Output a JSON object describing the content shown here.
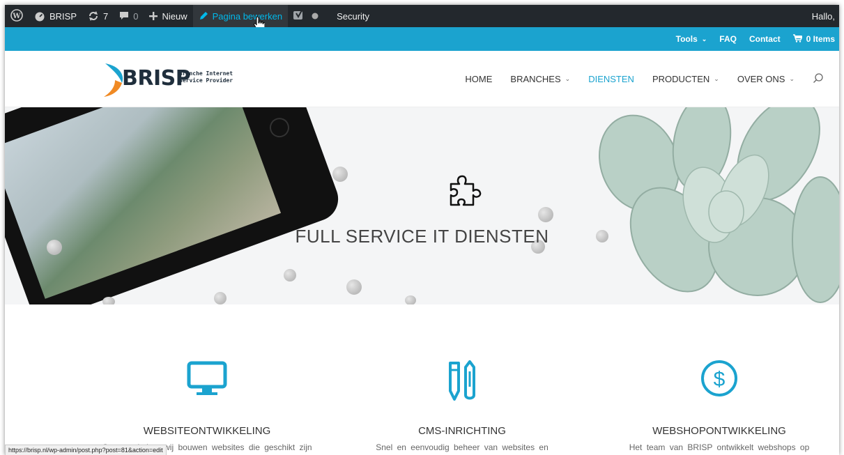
{
  "adminbar": {
    "site_name": "BRISP",
    "updates_count": "7",
    "comments_count": "0",
    "new_label": "Nieuw",
    "edit_page_label": "Pagina bewerken",
    "security_label": "Security",
    "greeting": "Hallo,"
  },
  "topbar": {
    "tools_label": "Tools",
    "faq_label": "FAQ",
    "contact_label": "Contact",
    "cart_label": "0 Items"
  },
  "header": {
    "logo_text": "BRISP",
    "logo_tagline_1": "Branche Internet",
    "logo_tagline_2": "Service Provider",
    "nav": {
      "home": "HOME",
      "branches": "BRANCHES",
      "diensten": "DIENSTEN",
      "producten": "PRODUCTEN",
      "over_ons": "OVER ONS"
    }
  },
  "hero": {
    "icon": "puzzle-piece-icon",
    "title": "FULL SERVICE IT DIENSTEN"
  },
  "services": [
    {
      "icon": "monitor-icon",
      "title": "WEBSITEONTWIKKELING",
      "text": "Geen websites wij bouwen websites die geschikt zijn"
    },
    {
      "icon": "pencil-pen-icon",
      "title": "CMS-INRICHTING",
      "text": "Snel en eenvoudig beheer van websites en"
    },
    {
      "icon": "dollar-icon",
      "title": "WEBSHOPONTWIKKELING",
      "text": "Het team van BRISP ontwikkelt webshops op"
    }
  ],
  "statusbar": {
    "url": "https://brisp.nl/wp-admin/post.php?post=81&action=edit"
  },
  "colors": {
    "accent": "#1ba3cf",
    "admin_bar": "#23282d",
    "admin_highlight": "#00b9eb"
  }
}
